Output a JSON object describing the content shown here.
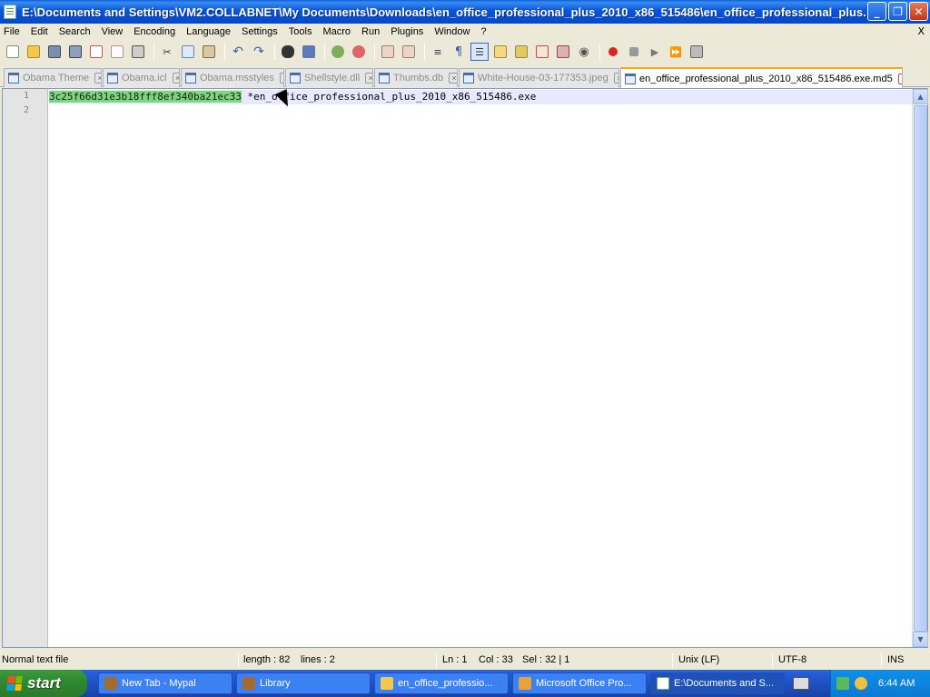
{
  "window": {
    "title": "E:\\Documents and Settings\\VM2.COLLABNET\\My Documents\\Downloads\\en_office_professional_plus_2010_x86_515486\\en_office_professional_plus...",
    "minimize": "_",
    "maximize": "❐",
    "close": "✕"
  },
  "menu": {
    "items": [
      "File",
      "Edit",
      "Search",
      "View",
      "Encoding",
      "Language",
      "Settings",
      "Tools",
      "Macro",
      "Run",
      "Plugins",
      "Window",
      "?"
    ],
    "close_doc": "X"
  },
  "toolbar": {
    "icons": [
      "new-file-icon",
      "open-file-icon",
      "save-icon",
      "save-all-icon",
      "close-icon",
      "close-all-icon",
      "print-icon",
      "cut-icon",
      "copy-icon",
      "paste-icon",
      "undo-icon",
      "redo-icon",
      "find-icon",
      "replace-icon",
      "zoom-in-icon",
      "zoom-out-icon",
      "sync-vertical-icon",
      "sync-horizontal-icon",
      "word-wrap-icon",
      "show-all-chars-icon",
      "indent-guide-icon",
      "user-lang-icon",
      "doc-map-icon",
      "function-list-icon",
      "folder-workspace-icon",
      "monitoring-icon",
      "record-macro-icon",
      "stop-macro-icon",
      "play-macro-icon",
      "run-macro-multiple-icon",
      "save-macro-icon"
    ]
  },
  "tabs": [
    {
      "label": "Obama Theme",
      "active": false
    },
    {
      "label": "Obama.icl",
      "active": false
    },
    {
      "label": "Obama.msstyles",
      "active": false
    },
    {
      "label": "Shellstyle.dll",
      "active": false
    },
    {
      "label": "Thumbs.db",
      "active": false
    },
    {
      "label": "White-House-03-177353.jpeg",
      "active": false
    },
    {
      "label": "en_office_professional_plus_2010_x86_515486.exe.md5",
      "active": true
    }
  ],
  "editor": {
    "line_numbers": [
      "1",
      "2"
    ],
    "line1_selected": "3c25f66d31e3b18fff8ef340ba21ec33",
    "line1_rest": " *en_office_professional_plus_2010_x86_515486.exe",
    "line2": ""
  },
  "status": {
    "file_type": "Normal text file",
    "length": "length : 82",
    "lines": "lines : 2",
    "ln": "Ln : 1",
    "col": "Col : 33",
    "sel": "Sel : 32 | 1",
    "eol": "Unix (LF)",
    "encoding": "UTF-8",
    "mode": "INS"
  },
  "taskbar": {
    "start": "start",
    "tasks": [
      {
        "label": "New Tab - Mypal",
        "active": false
      },
      {
        "label": "Library",
        "active": false
      },
      {
        "label": "en_office_professio...",
        "active": false
      },
      {
        "label": "Microsoft Office Pro...",
        "active": false
      },
      {
        "label": "E:\\Documents and S...",
        "active": true
      }
    ],
    "clock": "6:44 AM"
  },
  "colors": {
    "selection": "#7cd87c",
    "current_line": "#e8e8ff",
    "active_tab_accent": "#f5a623"
  }
}
